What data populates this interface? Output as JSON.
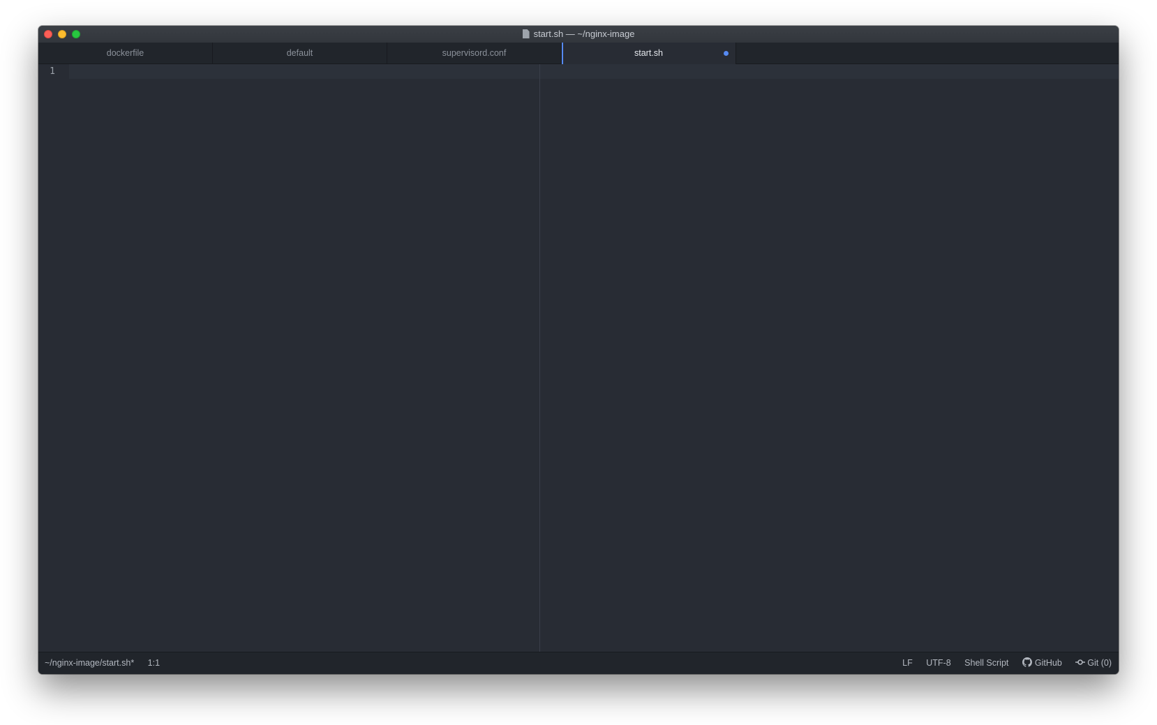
{
  "window": {
    "title": "start.sh — ~/nginx-image"
  },
  "tabs": [
    {
      "label": "dockerfile",
      "active": false,
      "modified": false
    },
    {
      "label": "default",
      "active": false,
      "modified": false
    },
    {
      "label": "supervisord.conf",
      "active": false,
      "modified": false
    },
    {
      "label": "start.sh",
      "active": true,
      "modified": true
    }
  ],
  "editor": {
    "line_numbers": [
      "1"
    ],
    "content": ""
  },
  "statusbar": {
    "file_path": "~/nginx-image/start.sh*",
    "cursor_position": "1:1",
    "line_ending": "LF",
    "encoding": "UTF-8",
    "grammar": "Shell Script",
    "github_label": "GitHub",
    "git_label": "Git (0)"
  },
  "colors": {
    "accent": "#568af2",
    "editor_bg": "#282c34",
    "chrome_bg": "#21252b"
  },
  "icons": {
    "title": "document-icon",
    "github": "github-icon",
    "git": "git-commit-icon"
  }
}
